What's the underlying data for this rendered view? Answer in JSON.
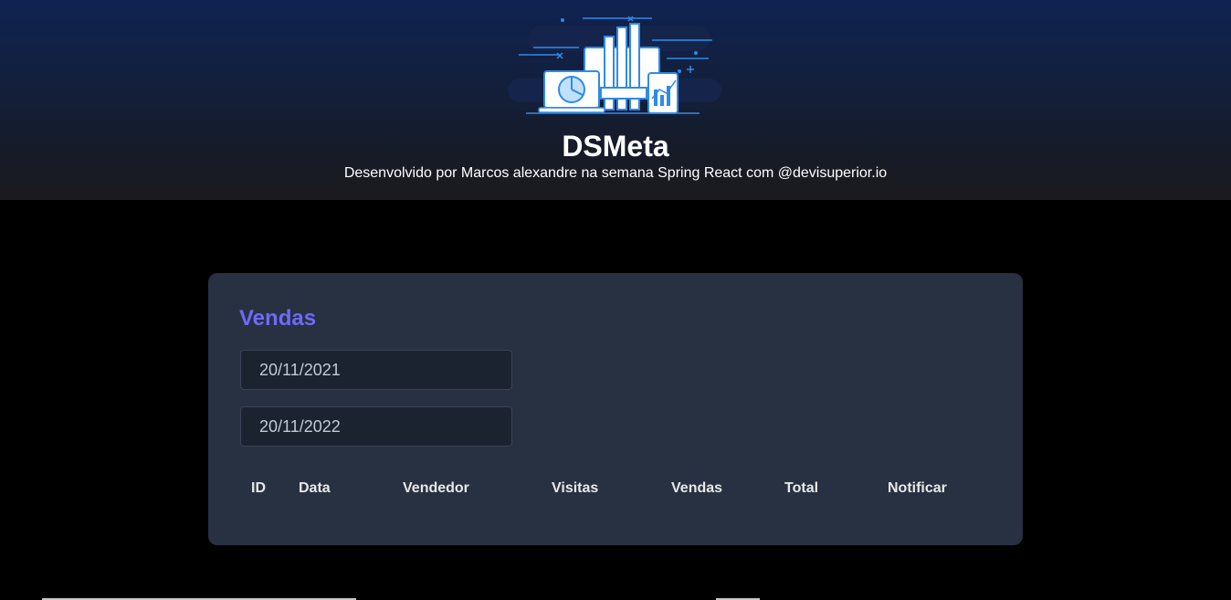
{
  "header": {
    "title": "DSMeta",
    "subtitle": "Desenvolvido por Marcos alexandre na semana Spring React com @devisuperior.io",
    "logo_icon": "dashboard-devices-illustration-icon"
  },
  "sales_card": {
    "title": "Vendas",
    "date_min": "20/11/2021",
    "date_max": "20/11/2022",
    "columns": [
      "ID",
      "Data",
      "Vendedor",
      "Visitas",
      "Vendas",
      "Total",
      "Notificar"
    ]
  },
  "colors": {
    "accent": "#6f6af8",
    "card_bg": "#283142",
    "input_bg": "#1c2330",
    "header_top": "#0f2252"
  }
}
